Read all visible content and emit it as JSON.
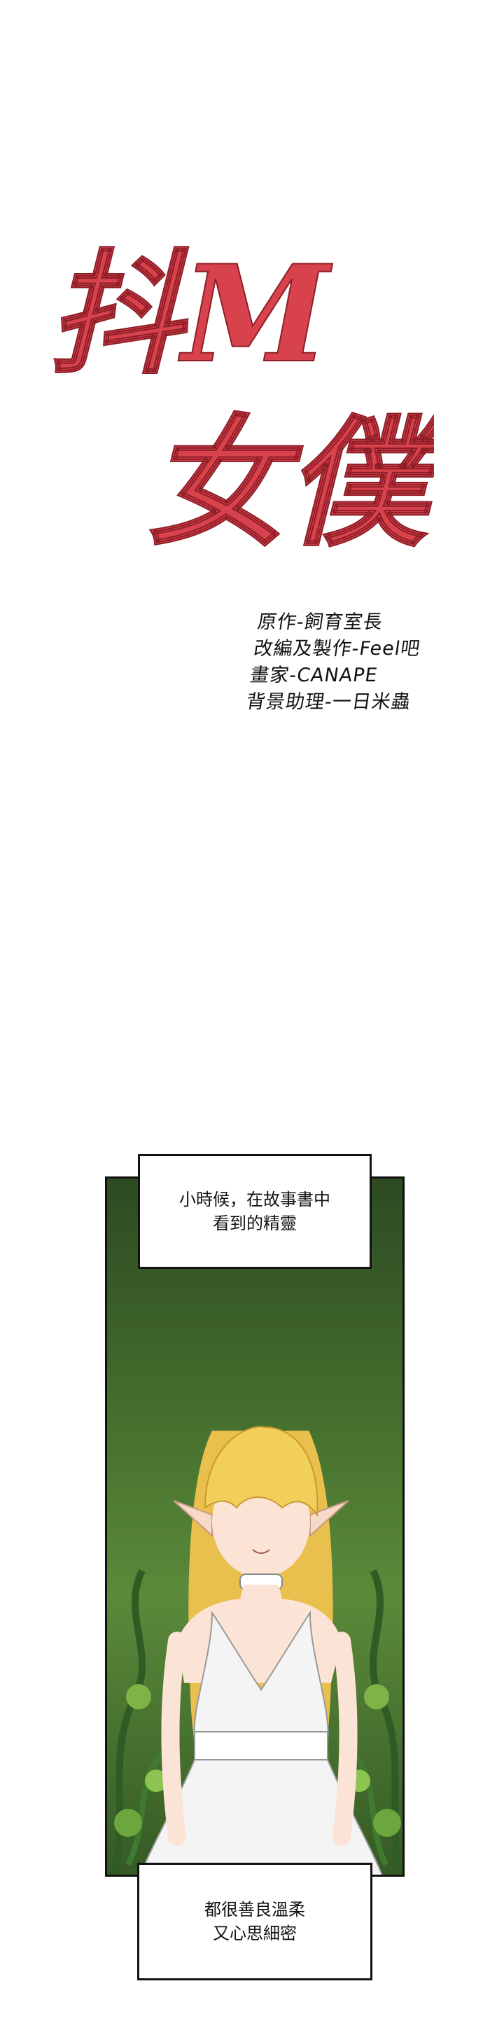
{
  "title": {
    "line1": "抖M",
    "line2": "女僕"
  },
  "credits": [
    "原作-飼育室長",
    "改編及製作-Feel吧",
    "畫家-CANAPE",
    "背景助理-一日米蟲"
  ],
  "captions": {
    "top_line1": "小時候，在故事書中",
    "top_line2": "看到的精靈",
    "bottom_line1": "都很善良溫柔",
    "bottom_line2": "又心思細密"
  },
  "colors": {
    "title_red": "#d8424d",
    "panel_green": "#46702d",
    "dress_white": "#f4f4f4",
    "hair_blonde": "#f2cf5b"
  }
}
